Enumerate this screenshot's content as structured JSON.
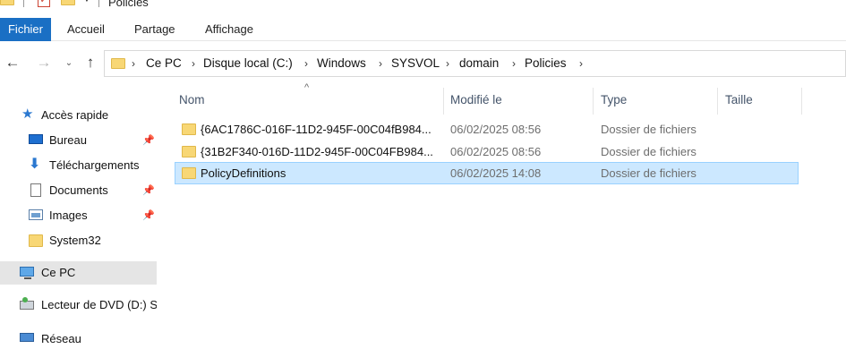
{
  "window": {
    "title": "Policies"
  },
  "quick_access_toolbar": {
    "items": [
      {
        "icon": "folder-icon"
      },
      {
        "icon": "checkbox-icon"
      },
      {
        "icon": "folder-icon"
      },
      {
        "icon": "dropdown-arrow-icon"
      }
    ]
  },
  "ribbon": {
    "tabs": [
      {
        "label": "Fichier",
        "active": true
      },
      {
        "label": "Accueil"
      },
      {
        "label": "Partage"
      },
      {
        "label": "Affichage"
      }
    ]
  },
  "navigation": {
    "back_icon": "arrow-left-icon",
    "forward_icon": "arrow-right-icon",
    "recent_icon": "chevron-down-icon",
    "up_icon": "arrow-up-icon"
  },
  "address_bar": {
    "breadcrumbs": [
      {
        "label": "Ce PC"
      },
      {
        "label": "Disque local (C:)"
      },
      {
        "label": "Windows"
      },
      {
        "label": "SYSVOL"
      },
      {
        "label": "domain"
      },
      {
        "label": "Policies"
      }
    ]
  },
  "nav_pane": {
    "items": [
      {
        "label": "Accès rapide",
        "icon": "star-icon"
      },
      {
        "label": "Bureau",
        "icon": "desktop-icon",
        "pinned": true
      },
      {
        "label": "Téléchargements",
        "icon": "download-icon",
        "pinned": true
      },
      {
        "label": "Documents",
        "icon": "document-icon",
        "pinned": true
      },
      {
        "label": "Images",
        "icon": "pictures-icon",
        "pinned": true
      },
      {
        "label": "System32",
        "icon": "folder-icon"
      },
      {
        "label": "Ce PC",
        "icon": "computer-icon",
        "selected": true
      },
      {
        "label": "Lecteur de DVD (D:) S",
        "icon": "dvd-drive-icon"
      },
      {
        "label": "Réseau",
        "icon": "network-icon"
      }
    ]
  },
  "file_list": {
    "columns": [
      {
        "label": "Nom",
        "sorted": "ascending"
      },
      {
        "label": "Modifié le"
      },
      {
        "label": "Type"
      },
      {
        "label": "Taille"
      }
    ],
    "rows": [
      {
        "name": "{6AC1786C-016F-11D2-945F-00C04fB984...",
        "modified": "06/02/2025 08:56",
        "type": "Dossier de fichiers",
        "size": ""
      },
      {
        "name": "{31B2F340-016D-11D2-945F-00C04FB984...",
        "modified": "06/02/2025 08:56",
        "type": "Dossier de fichiers",
        "size": ""
      },
      {
        "name": "PolicyDefinitions",
        "modified": "06/02/2025 14:08",
        "type": "Dossier de fichiers",
        "size": "",
        "selected": true
      }
    ]
  },
  "colors": {
    "file_tab": "#1a6fc4",
    "selection_bg": "#cce8ff",
    "selection_border": "#99d1ff",
    "nav_selected_bg": "#e5e5e5",
    "folder": "#f8d775"
  }
}
